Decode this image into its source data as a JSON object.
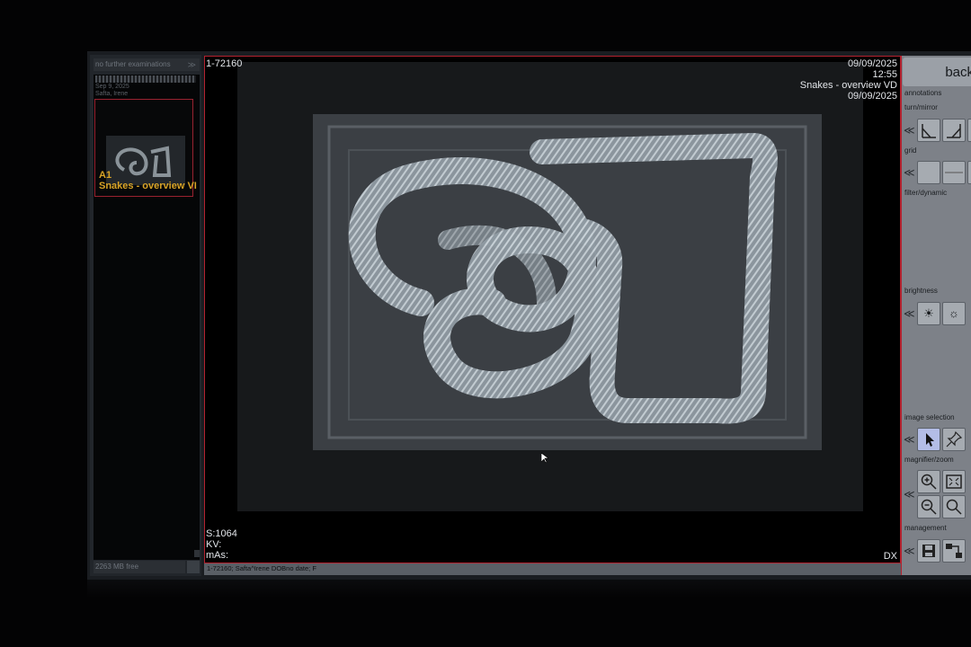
{
  "left_panel": {
    "header": "no further examinations",
    "header_arrow": "≫",
    "study_date": "Sep 9, 2025",
    "study_patient": "Safta, Irene",
    "thumbnail": {
      "label": "A1",
      "series": "Snakes - overview VI"
    },
    "free_space": "2263 MB free"
  },
  "viewer": {
    "image_id": "1-72160",
    "date": "09/09/2025",
    "time": "12:55",
    "series_title": "Snakes - overview VD",
    "date2": "09/09/2025",
    "s_value": "S:1064",
    "kv": "KV:",
    "mas": "mAs:",
    "modality": "DX"
  },
  "status_bar": "1-72160; Safta^Irene DOBno date; F",
  "right_panel": {
    "back_label": "back",
    "sections": {
      "annotations": "annotations",
      "turn_mirror": "turn/mirror",
      "grid": "grid",
      "filter_dynamic": "filter/dynamic",
      "brightness": "brightness",
      "image_selection": "image selection",
      "magnifier_zoom": "magnifier/zoom",
      "management": "management"
    },
    "collapse_glyph": "≪"
  },
  "colors": {
    "accent_border": "#b3222f",
    "thumbnail_text": "#d8a326",
    "panel_gray": "#7d8188",
    "selected_tool": "#b3bde6"
  }
}
